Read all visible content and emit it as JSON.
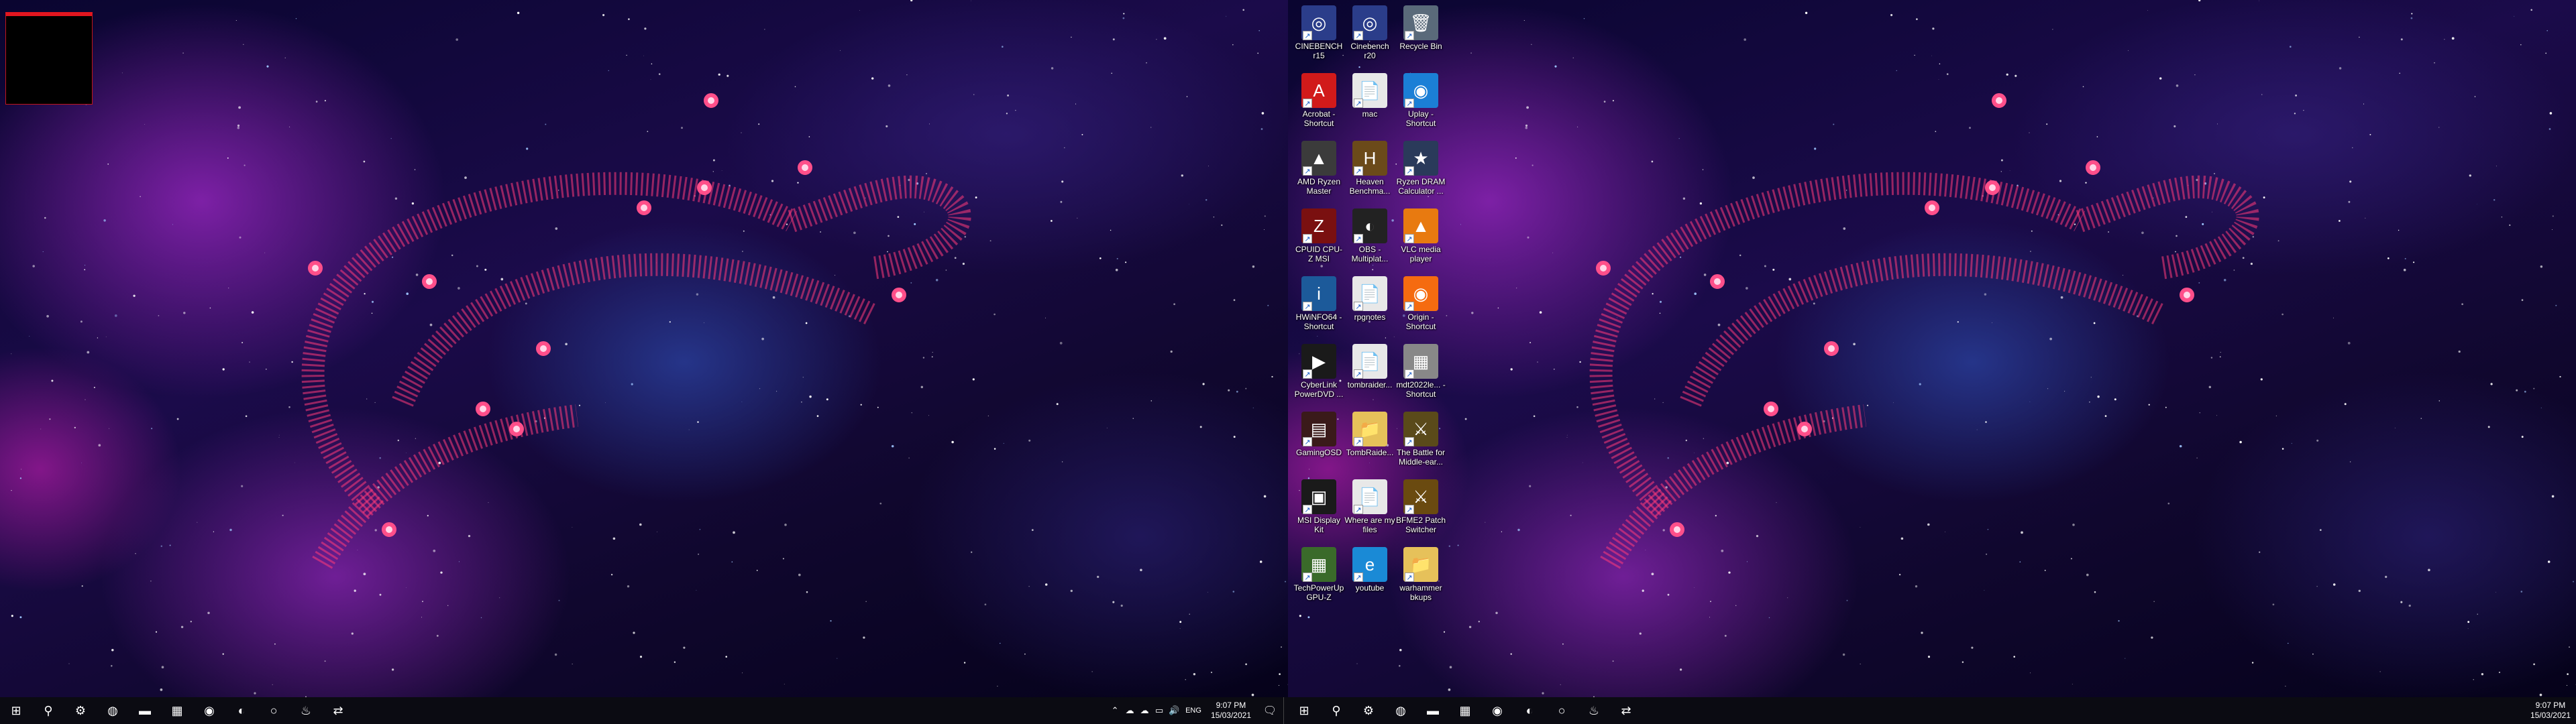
{
  "desktop_icons": [
    {
      "label": "CINEBENCH r15",
      "icon": "cinebench-icon",
      "color": "#2b3d8a",
      "glyph": "◎"
    },
    {
      "label": "Cinebench r20",
      "icon": "cinebench-icon",
      "color": "#2b3d8a",
      "glyph": "◎"
    },
    {
      "label": "Recycle Bin",
      "icon": "recycle-bin-icon",
      "color": "#5a6a7a",
      "glyph": "🗑"
    },
    {
      "label": "Acrobat - Shortcut",
      "icon": "acrobat-icon",
      "color": "#d11a1a",
      "glyph": "A"
    },
    {
      "label": "mac",
      "icon": "text-file-icon",
      "color": "#e8e8e8",
      "glyph": "📄"
    },
    {
      "label": "Uplay - Shortcut",
      "icon": "uplay-icon",
      "color": "#1b7fd6",
      "glyph": "◉"
    },
    {
      "label": "AMD Ryzen Master",
      "icon": "ryzen-master-icon",
      "color": "#3b3b3b",
      "glyph": "▲"
    },
    {
      "label": "Heaven Benchma...",
      "icon": "heaven-benchmark-icon",
      "color": "#6b4a1a",
      "glyph": "H"
    },
    {
      "label": "Ryzen DRAM Calculator ...",
      "icon": "dram-calculator-icon",
      "color": "#2a3a5a",
      "glyph": "★"
    },
    {
      "label": "CPUID CPU-Z MSI",
      "icon": "cpuz-icon",
      "color": "#7a1010",
      "glyph": "Z"
    },
    {
      "label": "OBS - Multiplat...",
      "icon": "obs-icon",
      "color": "#222222",
      "glyph": "◐"
    },
    {
      "label": "VLC media player",
      "icon": "vlc-icon",
      "color": "#e87a10",
      "glyph": "▲"
    },
    {
      "label": "HWiNFO64 - Shortcut",
      "icon": "hwinfo-icon",
      "color": "#1c5a9a",
      "glyph": "i"
    },
    {
      "label": "rpgnotes",
      "icon": "text-file-icon",
      "color": "#e8e8e8",
      "glyph": "📄"
    },
    {
      "label": "Origin - Shortcut",
      "icon": "origin-icon",
      "color": "#f56b10",
      "glyph": "◉"
    },
    {
      "label": "CyberLink PowerDVD ...",
      "icon": "powerdvd-icon",
      "color": "#1a1a1a",
      "glyph": "▶"
    },
    {
      "label": "tombraider...",
      "icon": "text-file-icon",
      "color": "#e8e8e8",
      "glyph": "📄"
    },
    {
      "label": "mdt2022le... - Shortcut",
      "icon": "game-shortcut-icon",
      "color": "#888888",
      "glyph": "▦"
    },
    {
      "label": "GamingOSD",
      "icon": "gaming-osd-icon",
      "color": "#3a1a1a",
      "glyph": "▤"
    },
    {
      "label": "TombRaide...",
      "icon": "folder-icon",
      "color": "#e6c15a",
      "glyph": "📁"
    },
    {
      "label": "The Battle for Middle-ear...",
      "icon": "bfme-icon",
      "color": "#5a4a1a",
      "glyph": "⚔"
    },
    {
      "label": "MSI Display Kit",
      "icon": "msi-display-kit-icon",
      "color": "#1a1a1a",
      "glyph": "▣"
    },
    {
      "label": "Where are my files",
      "icon": "text-file-icon",
      "color": "#e8e8e8",
      "glyph": "📄"
    },
    {
      "label": "BFME2 Patch Switcher",
      "icon": "patch-switcher-icon",
      "color": "#6a4a10",
      "glyph": "⚔"
    },
    {
      "label": "TechPowerUp GPU-Z",
      "icon": "gpuz-icon",
      "color": "#3a6a2a",
      "glyph": "▦"
    },
    {
      "label": "youtube",
      "icon": "edge-icon",
      "color": "#1a8ad6",
      "glyph": "e"
    },
    {
      "label": "warhammer bkups",
      "icon": "folder-icon",
      "color": "#e6c15a",
      "glyph": "📁"
    }
  ],
  "taskbar_left": [
    {
      "icon": "windows-start-icon",
      "glyph": "⊞"
    },
    {
      "icon": "search-icon",
      "glyph": "⚲"
    },
    {
      "icon": "settings-gear-icon",
      "glyph": "⚙"
    },
    {
      "icon": "edge-browser-icon",
      "glyph": "◍"
    },
    {
      "icon": "file-explorer-icon",
      "glyph": "▬"
    },
    {
      "icon": "microsoft-store-icon",
      "glyph": "▦"
    },
    {
      "icon": "origin-taskbar-icon",
      "glyph": "◉"
    },
    {
      "icon": "obs-taskbar-icon",
      "glyph": "◐"
    },
    {
      "icon": "cortana-icon",
      "glyph": "○"
    },
    {
      "icon": "steam-icon",
      "glyph": "♨"
    },
    {
      "icon": "network-app-icon",
      "glyph": "⇄"
    }
  ],
  "taskbar_right": [
    {
      "icon": "windows-start-icon",
      "glyph": "⊞"
    },
    {
      "icon": "search-icon",
      "glyph": "⚲"
    },
    {
      "icon": "settings-gear-icon",
      "glyph": "⚙"
    },
    {
      "icon": "edge-browser-icon",
      "glyph": "◍"
    },
    {
      "icon": "file-explorer-icon",
      "glyph": "▬"
    },
    {
      "icon": "microsoft-store-icon",
      "glyph": "▦"
    },
    {
      "icon": "origin-taskbar-icon",
      "glyph": "◉"
    },
    {
      "icon": "obs-taskbar-icon",
      "glyph": "◐"
    },
    {
      "icon": "cortana-icon",
      "glyph": "○"
    },
    {
      "icon": "steam-icon",
      "glyph": "♨"
    },
    {
      "icon": "network-app-icon",
      "glyph": "⇄"
    }
  ],
  "tray": {
    "language": "ENG",
    "time": "9:07 PM",
    "date": "15/03/2021",
    "icons": [
      "chevron-up-icon",
      "onedrive-icon",
      "cloud-icon",
      "network-icon",
      "volume-icon"
    ]
  }
}
